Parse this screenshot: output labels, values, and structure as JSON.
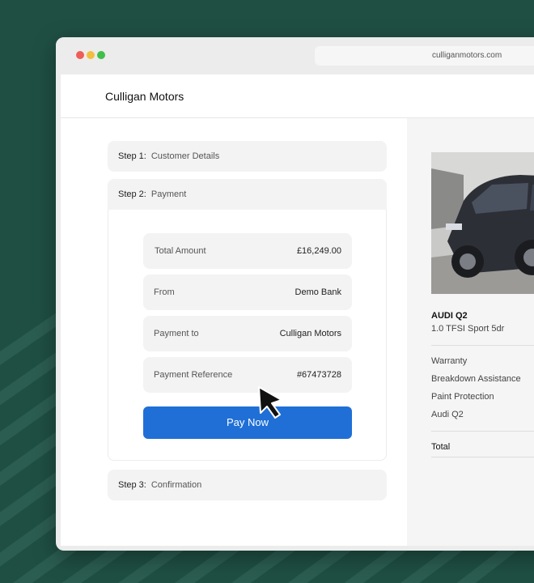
{
  "browser": {
    "url": "culliganmotors.com"
  },
  "header": {
    "brand": "Culligan Motors"
  },
  "steps": [
    {
      "num": "Step 1:",
      "name": "Customer Details"
    },
    {
      "num": "Step 2:",
      "name": "Payment"
    },
    {
      "num": "Step 3:",
      "name": "Confirmation"
    }
  ],
  "payment": {
    "rows": [
      {
        "label": "Total Amount",
        "value": "£16,249.00"
      },
      {
        "label": "From",
        "value": "Demo Bank"
      },
      {
        "label": "Payment to",
        "value": "Culligan Motors"
      },
      {
        "label": "Payment Reference",
        "value": "#67473728"
      }
    ],
    "pay_button": "Pay Now"
  },
  "summary": {
    "car_title": "AUDI Q2",
    "car_subtitle": "1.0 TFSI Sport 5dr",
    "items": [
      "Warranty",
      "Breakdown Assistance",
      "Paint Protection",
      "Audi Q2"
    ],
    "total_label": "Total"
  },
  "colors": {
    "background": "#1f4f43",
    "primary_button": "#1f6fd6"
  },
  "icons": {
    "cursor": "pointer-cursor-icon",
    "window_controls": [
      "close-dot-icon",
      "minimize-dot-icon",
      "maximize-dot-icon"
    ]
  }
}
